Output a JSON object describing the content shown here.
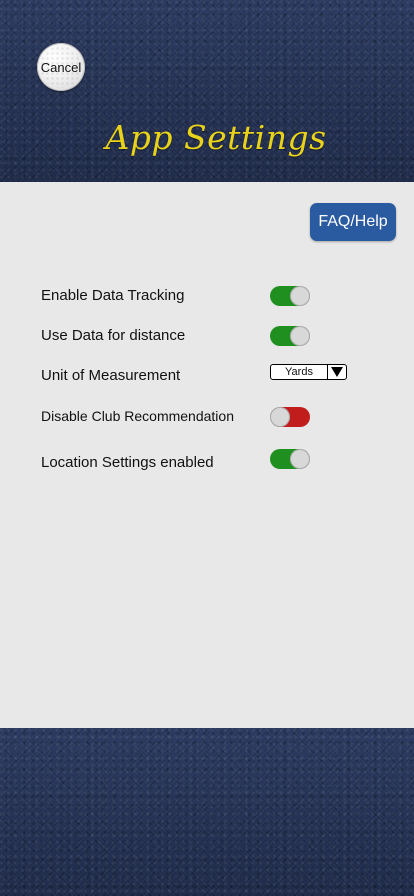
{
  "header": {
    "cancel_label": "Cancel",
    "title": "App Settings"
  },
  "main": {
    "faq_label": "FAQ/Help",
    "settings": [
      {
        "label": "Enable Data Tracking",
        "type": "toggle",
        "state": "on",
        "color": "#1f8f1f"
      },
      {
        "label": "Use Data for distance",
        "type": "toggle",
        "state": "on",
        "color": "#1f8f1f"
      },
      {
        "label": "Unit of Measurement",
        "type": "select",
        "value": "Yards"
      },
      {
        "label": "Disable Club Recommendation",
        "type": "toggle",
        "state": "off",
        "color": "#c21d1d"
      },
      {
        "label": "Location Settings enabled",
        "type": "toggle",
        "state": "on",
        "color": "#1f8f1f"
      }
    ]
  },
  "colors": {
    "title": "#e9d21a",
    "faq_button": "#2a5aa0",
    "panel": "#e8e8e8",
    "background": "#26345a"
  },
  "icons": {
    "select_arrow": "triangle-down-icon"
  }
}
